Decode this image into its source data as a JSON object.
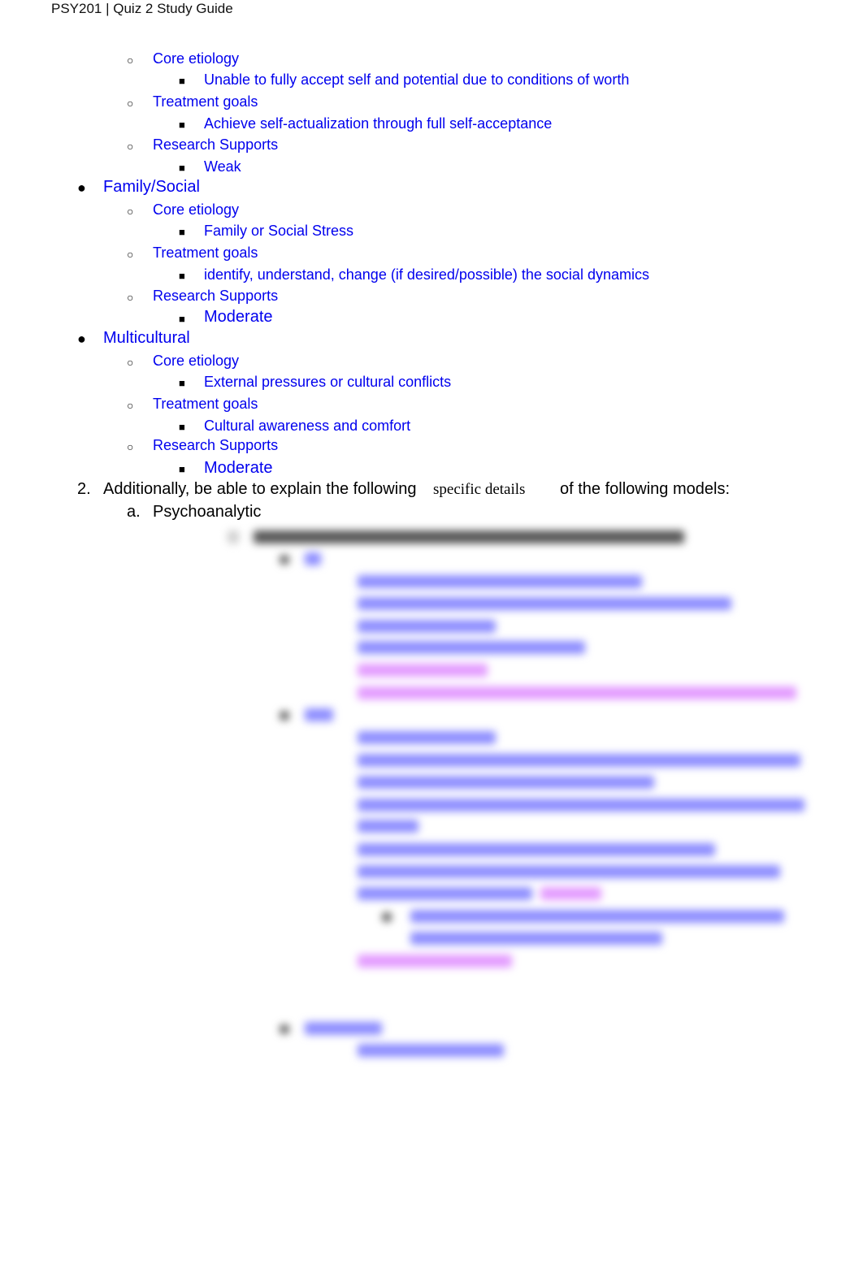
{
  "header": {
    "title": "PSY201 | Quiz 2 Study Guide"
  },
  "section1": {
    "humanistic_tail": {
      "core_etiology_label": "Core etiology",
      "core_etiology_value": "Unable to fully accept self and potential due to conditions of worth",
      "treatment_goals_label": "Treatment goals",
      "treatment_goals_value": "Achieve self-actualization through full self-acceptance",
      "research_label": "Research Supports",
      "research_value": "Weak"
    },
    "family_social": {
      "title": "Family/Social",
      "core_etiology_label": "Core etiology",
      "core_etiology_value": "Family or Social Stress",
      "treatment_goals_label": "Treatment goals",
      "treatment_goals_value": "identify, understand, change (if desired/possible) the social dynamics",
      "research_label": "Research Supports",
      "research_value": "Moderate"
    },
    "multicultural": {
      "title": "Multicultural",
      "core_etiology_label": "Core etiology",
      "core_etiology_value": "External pressures or cultural conflicts",
      "treatment_goals_label": "Treatment goals",
      "treatment_goals_value": "Cultural awareness and comfort",
      "research_label": "Research Supports",
      "research_value": "Moderate"
    }
  },
  "section2": {
    "number": "2.",
    "text_before": "Additionally, be able to explain the following",
    "text_serif": "specific details",
    "text_after": "of the following models:",
    "sub_a_label": "a.",
    "sub_a_title": "Psychoanalytic"
  },
  "markers": {
    "bullet": "●",
    "circle": "○",
    "square": "■"
  },
  "blurred_section": {
    "note": "content obscured (blurred preview)"
  }
}
